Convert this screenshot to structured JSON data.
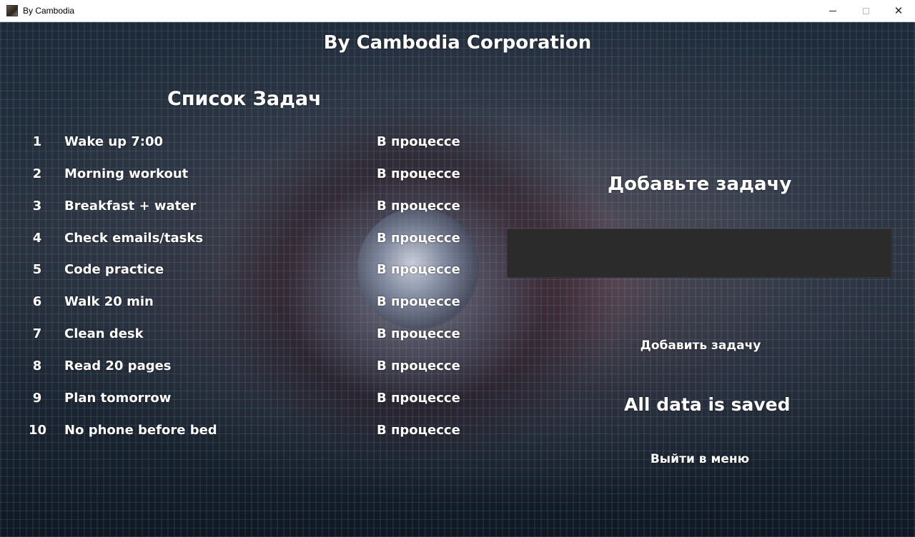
{
  "window": {
    "title": "By Cambodia",
    "controls": {
      "minimize_icon": "minimize-icon",
      "maximize_icon": "maximize-icon",
      "close_icon": "close-icon",
      "close_glyph": "✕"
    }
  },
  "header": {
    "title": "By Cambodia Corporation"
  },
  "task_list": {
    "heading": "Список Задач",
    "tasks": [
      {
        "number": "1",
        "title": "Wake up 7:00",
        "status": "В процессе"
      },
      {
        "number": "2",
        "title": "Morning workout",
        "status": "В процессе"
      },
      {
        "number": "3",
        "title": "Breakfast + water",
        "status": "В процессе"
      },
      {
        "number": "4",
        "title": "Check emails/tasks",
        "status": "В процессе"
      },
      {
        "number": "5",
        "title": "Code practice",
        "status": "В процессе"
      },
      {
        "number": "6",
        "title": "Walk 20 min",
        "status": "В процессе"
      },
      {
        "number": "7",
        "title": "Clean desk",
        "status": "В процессе"
      },
      {
        "number": "8",
        "title": "Read 20 pages",
        "status": "В процессе"
      },
      {
        "number": "9",
        "title": "Plan tomorrow",
        "status": "В процессе"
      },
      {
        "number": "10",
        "title": "No phone before bed",
        "status": "В процессе"
      }
    ]
  },
  "add_panel": {
    "heading": "Добавьте задачу",
    "input_value": "",
    "input_placeholder": "",
    "add_button_label": "Добавить задачу",
    "save_status": "All data is saved",
    "exit_button_label": "Выйти в меню"
  },
  "colors": {
    "text": "#ffffff",
    "input_background": "#2b2b2b",
    "titlebar_background": "#ffffff"
  }
}
